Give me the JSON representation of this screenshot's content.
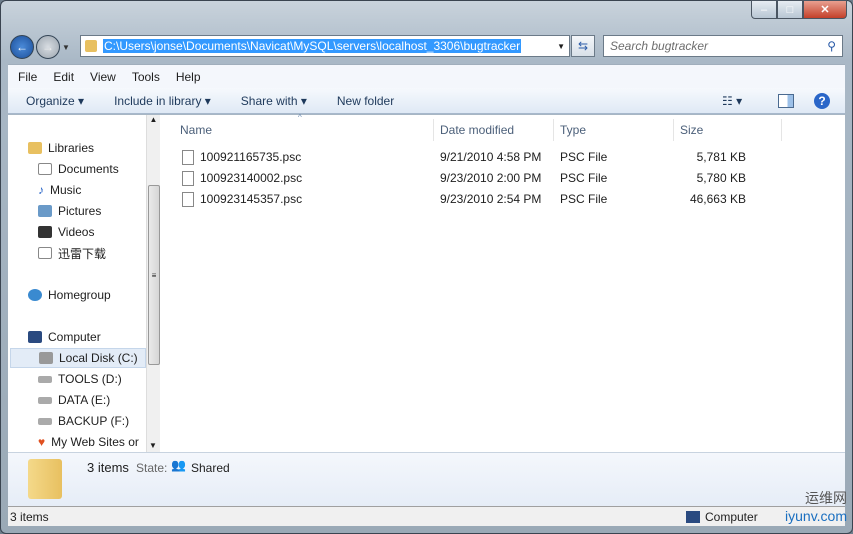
{
  "address": {
    "path": "C:\\Users\\jonse\\Documents\\Navicat\\MySQL\\servers\\localhost_3306\\bugtracker"
  },
  "search": {
    "placeholder": "Search bugtracker"
  },
  "menu": [
    "File",
    "Edit",
    "View",
    "Tools",
    "Help"
  ],
  "toolbar": {
    "organize": "Organize ▾",
    "include": "Include in library ▾",
    "share": "Share with ▾",
    "newfolder": "New folder"
  },
  "nav": {
    "libraries": "Libraries",
    "documents": "Documents",
    "music": "Music",
    "pictures": "Pictures",
    "videos": "Videos",
    "xunlei": "迅雷下载",
    "homegroup": "Homegroup",
    "computer": "Computer",
    "localdisk": "Local Disk (C:)",
    "tools": "TOOLS (D:)",
    "data": "DATA (E:)",
    "backup": "BACKUP (F:)",
    "websites": "My Web Sites or"
  },
  "columns": {
    "name": "Name",
    "date": "Date modified",
    "type": "Type",
    "size": "Size"
  },
  "files": [
    {
      "name": "100921165735.psc",
      "date": "9/21/2010 4:58 PM",
      "type": "PSC File",
      "size": "5,781 KB"
    },
    {
      "name": "100923140002.psc",
      "date": "9/23/2010 2:00 PM",
      "type": "PSC File",
      "size": "5,780 KB"
    },
    {
      "name": "100923145357.psc",
      "date": "9/23/2010 2:54 PM",
      "type": "PSC File",
      "size": "46,663 KB"
    }
  ],
  "details": {
    "count": "3 items",
    "state_label": "State:",
    "state": "Shared"
  },
  "status": {
    "count": "3 items",
    "location": "Computer"
  },
  "watermark": {
    "cn": "运维网",
    "url": "iyunv.com"
  }
}
